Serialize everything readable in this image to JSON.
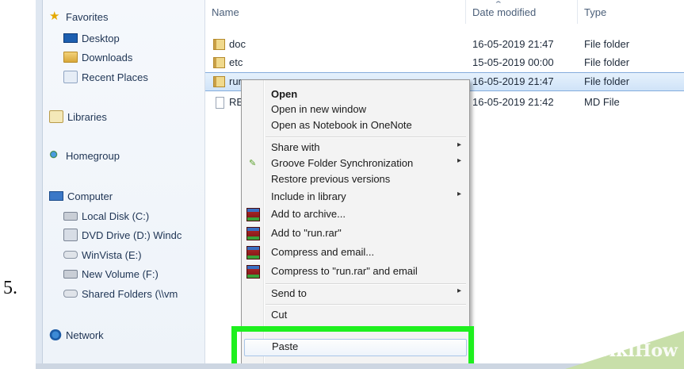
{
  "step_number": "5.",
  "nav": {
    "items": [
      {
        "name": "favorites",
        "label": "Favorites",
        "icon": "star-icon"
      },
      {
        "name": "desktop",
        "label": "Desktop",
        "icon": "desktop-icon"
      },
      {
        "name": "downloads",
        "label": "Downloads",
        "icon": "downloads-folder-icon"
      },
      {
        "name": "recent-places",
        "label": "Recent Places",
        "icon": "recent-places-icon"
      },
      {
        "name": "libraries",
        "label": "Libraries",
        "icon": "libraries-icon"
      },
      {
        "name": "homegroup",
        "label": "Homegroup",
        "icon": "homegroup-icon"
      },
      {
        "name": "computer",
        "label": "Computer",
        "icon": "computer-icon"
      },
      {
        "name": "local-disk",
        "label": "Local Disk (C:)",
        "icon": "local-disk-icon"
      },
      {
        "name": "dvd-drive",
        "label": "DVD Drive (D:) Windc",
        "icon": "dvd-drive-icon"
      },
      {
        "name": "winvista",
        "label": "WinVista (E:)",
        "icon": "drive-icon"
      },
      {
        "name": "new-volume",
        "label": "New Volume (F:)",
        "icon": "network-drive-icon"
      },
      {
        "name": "shared-folders",
        "label": "Shared Folders (\\\\vm",
        "icon": "shared-folder-icon"
      },
      {
        "name": "network",
        "label": "Network",
        "icon": "network-icon"
      }
    ]
  },
  "columns": {
    "name": "Name",
    "date_modified": "Date modified",
    "type": "Type"
  },
  "files": [
    {
      "name": "doc",
      "date": "16-05-2019 21:47",
      "type": "File folder",
      "icon": "folder-icon",
      "selected": false
    },
    {
      "name": "etc",
      "date": "15-05-2019 00:00",
      "type": "File folder",
      "icon": "folder-icon",
      "selected": false
    },
    {
      "name": "rur",
      "date": "16-05-2019 21:47",
      "type": "File folder",
      "icon": "folder-icon",
      "selected": true
    },
    {
      "name": "RE",
      "date": "16-05-2019 21:42",
      "type": "MD File",
      "icon": "file-icon",
      "selected": false
    }
  ],
  "menu": {
    "open": "Open",
    "open_new_window": "Open in new window",
    "open_onenote": "Open as Notebook in OneNote",
    "share_with": "Share with",
    "groove": "Groove Folder Synchronization",
    "restore": "Restore previous versions",
    "include_library": "Include in library",
    "add_archive": "Add to archive...",
    "add_run_rar": "Add to \"run.rar\"",
    "compress_email": "Compress and email...",
    "compress_run_email": "Compress to \"run.rar\" and email",
    "send_to": "Send to",
    "cut": "Cut",
    "paste": "Paste",
    "submenu_arrow": "▸"
  },
  "watermark": {
    "wiki": "wiki",
    "how": "How"
  },
  "colors": {
    "highlight": "#1ef01e",
    "selection": "#cfe3f8"
  }
}
